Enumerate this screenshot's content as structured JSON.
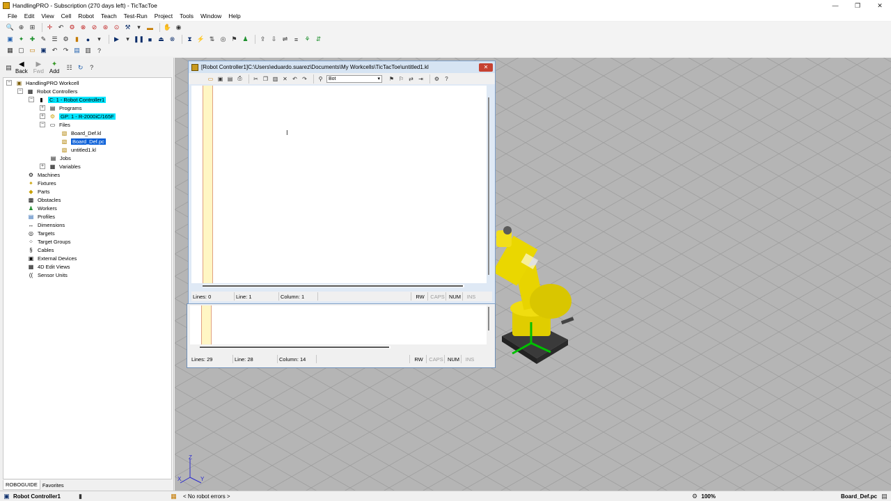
{
  "window": {
    "title": "HandlingPRO - Subscription (270 days left) - TicTacToe"
  },
  "menus": [
    "File",
    "Edit",
    "View",
    "Cell",
    "Robot",
    "Teach",
    "Test-Run",
    "Project",
    "Tools",
    "Window",
    "Help"
  ],
  "nav": {
    "back": "Back",
    "fwd": "Fwd",
    "add": "Add"
  },
  "tree": {
    "root": "HandlingPRO Workcell",
    "robot_controllers": "Robot Controllers",
    "controller": "C: 1 - Robot Controller1",
    "programs": "Programs",
    "group": "GP: 1 - R-2000iC/165F",
    "files": "Files",
    "file1": "Board_Def.kl",
    "file2": "Board_Def.pc",
    "file3": "untitled1.kl",
    "jobs": "Jobs",
    "variables": "Variables",
    "machines": "Machines",
    "fixtures": "Fixtures",
    "parts": "Parts",
    "obstacles": "Obstacles",
    "workers": "Workers",
    "profiles": "Profiles",
    "dimensions": "Dimensions",
    "targets": "Targets",
    "target_groups": "Target Groups",
    "cables": "Cables",
    "external_devices": "External Devices",
    "edit_views": "4D Edit Views",
    "sensor_units": "Sensor Units"
  },
  "left_tabs": {
    "robo": "ROBOGUIDE",
    "fav": "Favorites"
  },
  "editor_front": {
    "title": "[Robot Controller1]C:\\Users\\eduardo.suarez\\Documents\\My Workcells\\TicTacToe\\untitled1.kl",
    "search_value": "Bot",
    "lines": "Lines: 0",
    "line": "Line: 1",
    "column": "Column: 1"
  },
  "editor_back": {
    "lines": "Lines: 29",
    "line": "Line: 28",
    "column": "Column: 14"
  },
  "indicators": {
    "rw": "RW",
    "caps": "CAPS",
    "num": "NUM",
    "ins": "INS"
  },
  "status": {
    "controller": "Robot Controller1",
    "errors": "< No robot errors >",
    "zoom": "100%",
    "file": "Board_Def.pc"
  },
  "colors": {
    "highlight_cyan": "#00e5ff",
    "selection_blue": "#0a5fd8",
    "robot_yellow": "#e8d400",
    "floor_gray": "#b5b5b5"
  }
}
